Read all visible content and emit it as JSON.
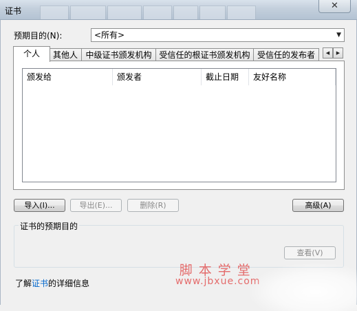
{
  "window": {
    "title": "证书",
    "close_glyph": "✕"
  },
  "purpose": {
    "label": "预期目的(N):",
    "selected": "<所有>"
  },
  "tabs": [
    {
      "label": "个人",
      "active": true
    },
    {
      "label": "其他人",
      "active": false
    },
    {
      "label": "中级证书颁发机构",
      "active": false
    },
    {
      "label": "受信任的根证书颁发机构",
      "active": false
    },
    {
      "label": "受信任的发布者",
      "active": false
    }
  ],
  "list": {
    "columns": [
      "颁发给",
      "颁发者",
      "截止日期",
      "友好名称"
    ],
    "rows": []
  },
  "buttons": {
    "import": "导入(I)...",
    "export": "导出(E)...",
    "remove": "删除(R)",
    "advanced": "高级(A)",
    "view": "查看(V)"
  },
  "purposes_group": {
    "label": "证书的预期目的"
  },
  "footer": {
    "prefix": "了解",
    "link": "证书",
    "suffix": "的详细信息"
  },
  "watermark": {
    "cn": "脚本学堂",
    "url": "www.jbxue.com"
  },
  "colors": {
    "link": "#0066cc",
    "watermark": "#e46b6b"
  }
}
